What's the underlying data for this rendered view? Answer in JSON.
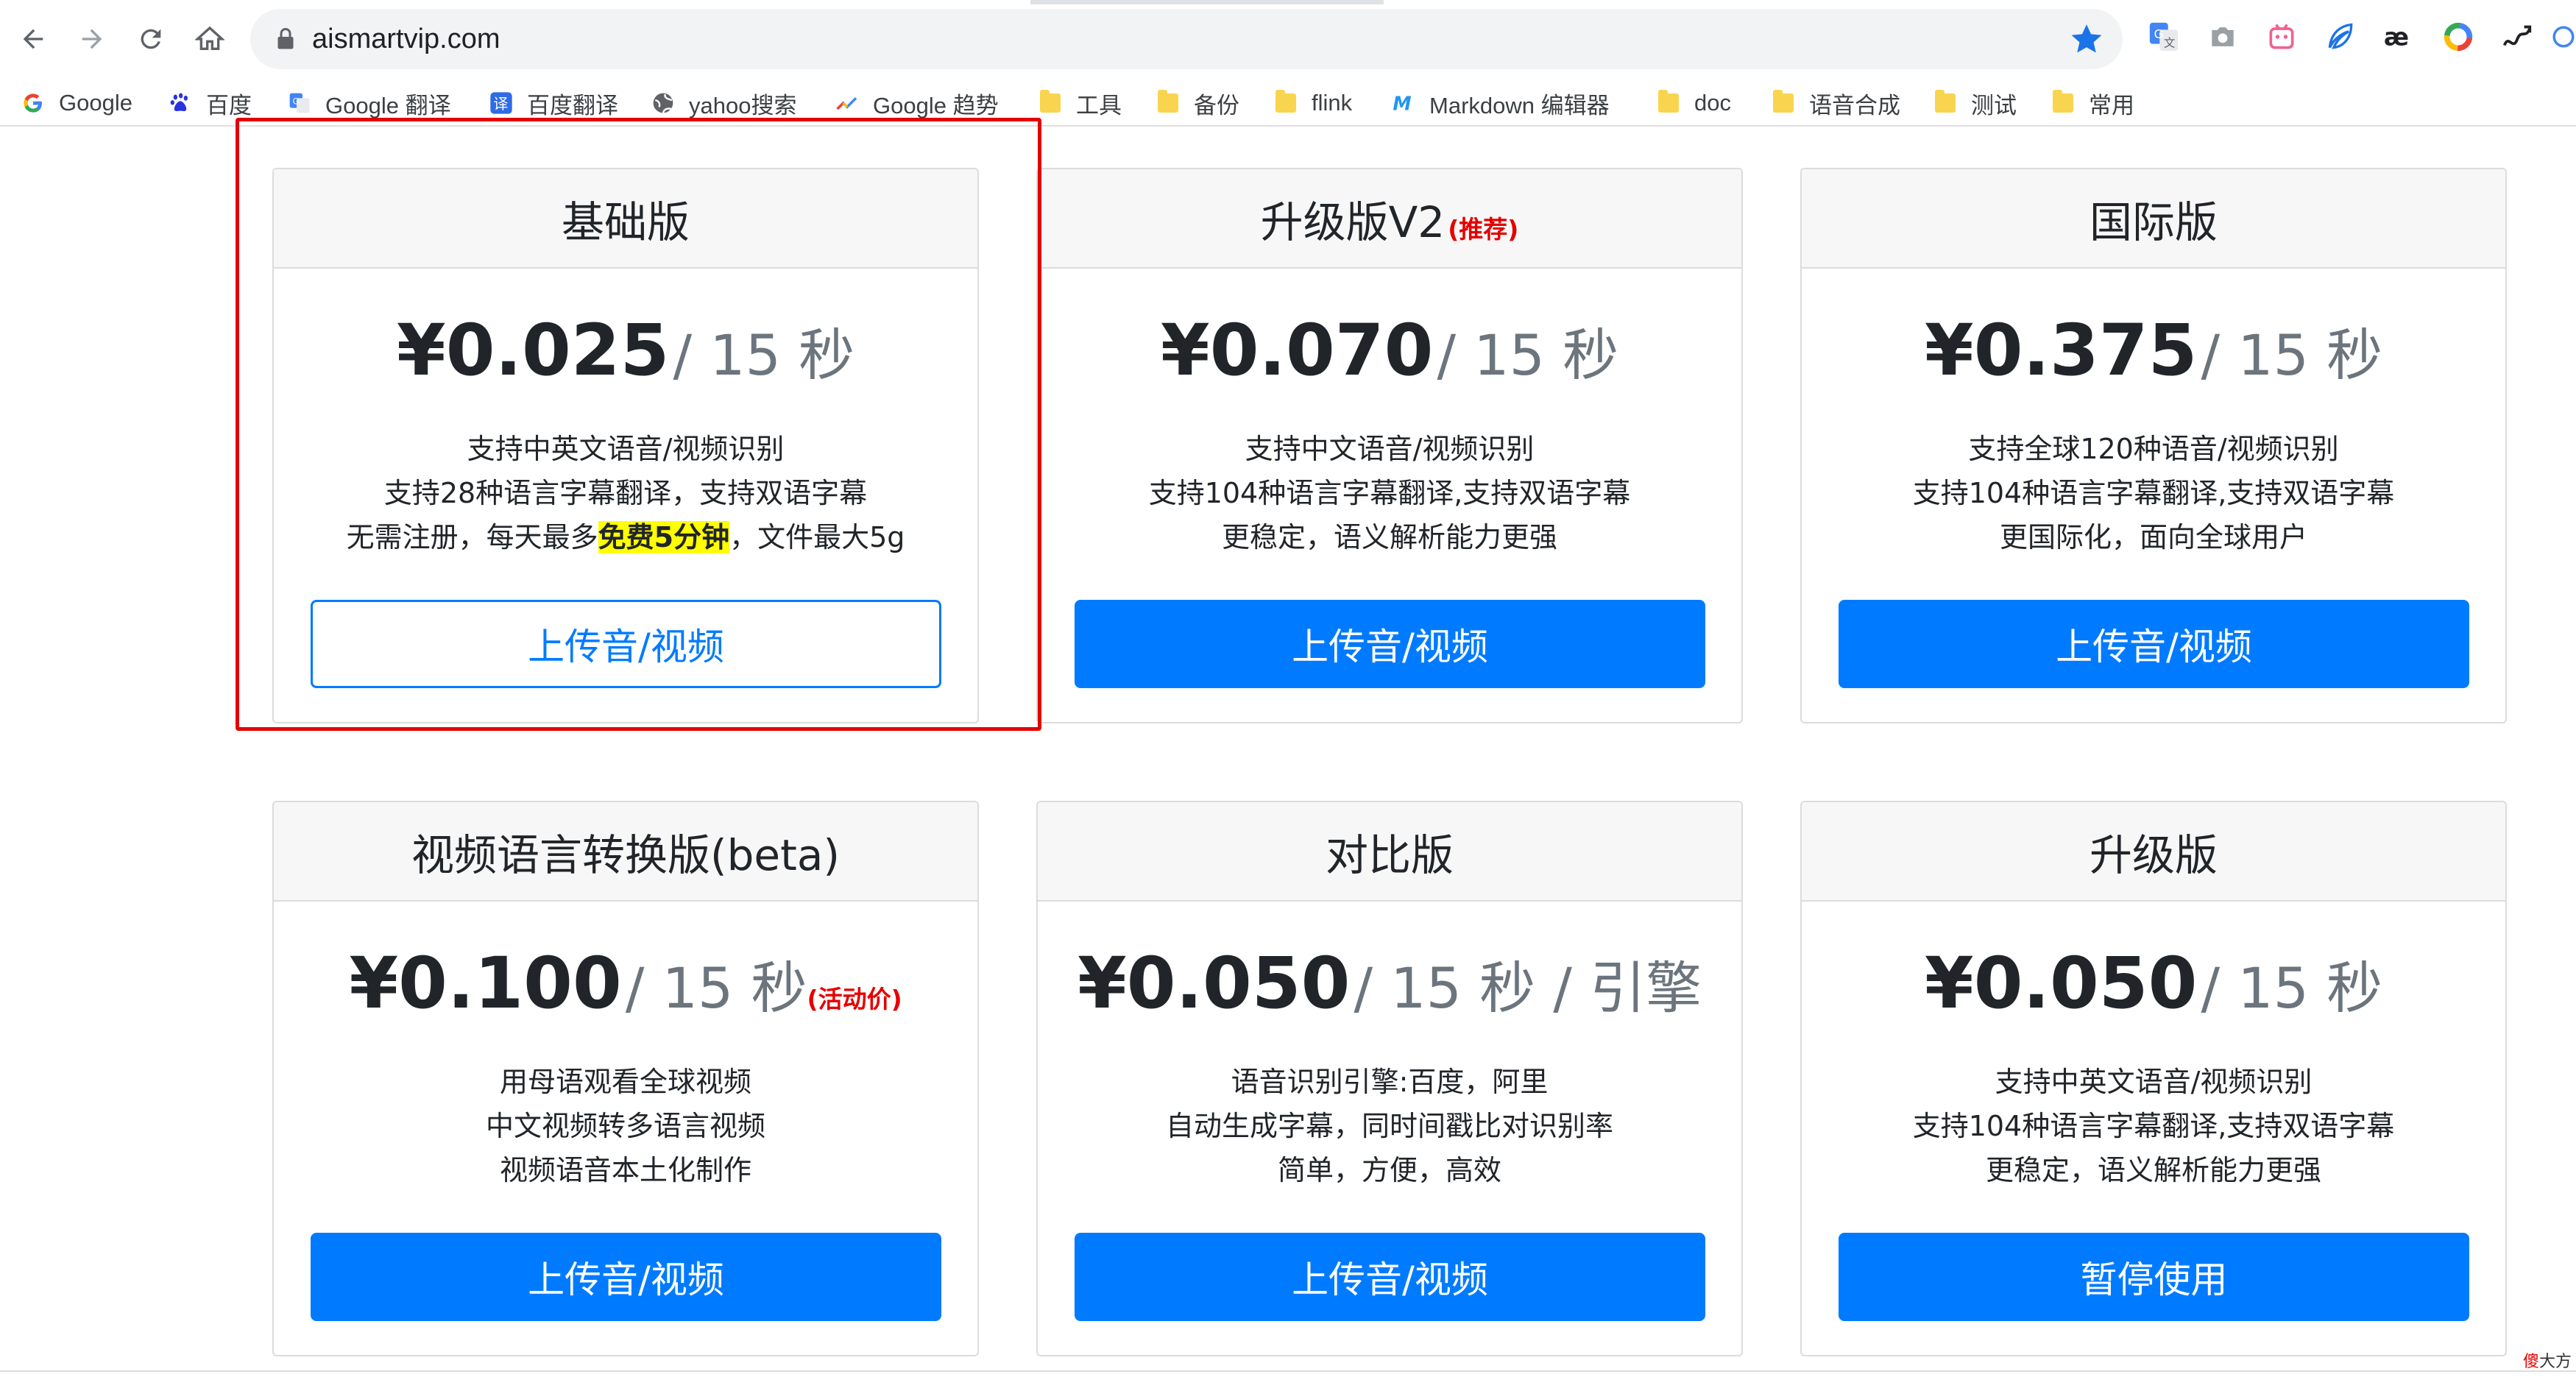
{
  "browser": {
    "url": "aismartvip.com",
    "bookmarks": [
      {
        "label": "Google",
        "icon": "google-icon"
      },
      {
        "label": "百度",
        "icon": "baidu-paw-icon"
      },
      {
        "label": "Google 翻译",
        "icon": "google-translate-icon"
      },
      {
        "label": "百度翻译",
        "icon": "baidu-translate-icon"
      },
      {
        "label": "yahoo搜索",
        "icon": "globe-icon"
      },
      {
        "label": "Google 趋势",
        "icon": "trends-icon"
      },
      {
        "label": "工具",
        "icon": "folder-icon"
      },
      {
        "label": "备份",
        "icon": "folder-icon"
      },
      {
        "label": "flink",
        "icon": "folder-icon"
      },
      {
        "label": "Markdown 编辑器",
        "icon": "markdown-icon"
      },
      {
        "label": "doc",
        "icon": "folder-icon"
      },
      {
        "label": "语音合成",
        "icon": "folder-icon"
      },
      {
        "label": "测试",
        "icon": "folder-icon"
      },
      {
        "label": "常用",
        "icon": "folder-icon"
      }
    ]
  },
  "cards": [
    {
      "title": "基础版",
      "title_note": "",
      "price": "¥0.025",
      "unit": "/ 15 秒",
      "unit_note": "",
      "features": [
        "支持中英文语音/视频识别",
        "支持28种语言字幕翻译，支持双语字幕"
      ],
      "feature3_pre": "无需注册，每天最多",
      "feature3_highlight": "免费5分钟",
      "feature3_post": "，文件最大5g",
      "button": "上传音/视频",
      "button_style": "outline"
    },
    {
      "title": "升级版V2",
      "title_note": "(推荐)",
      "price": "¥0.070",
      "unit": "/ 15 秒",
      "unit_note": "",
      "features": [
        "支持中文语音/视频识别",
        "支持104种语言字幕翻译,支持双语字幕",
        "更稳定，语义解析能力更强"
      ],
      "button": "上传音/视频",
      "button_style": "primary"
    },
    {
      "title": "国际版",
      "title_note": "",
      "price": "¥0.375",
      "unit": "/ 15 秒",
      "unit_note": "",
      "features": [
        "支持全球120种语音/视频识别",
        "支持104种语言字幕翻译,支持双语字幕",
        "更国际化，面向全球用户"
      ],
      "button": "上传音/视频",
      "button_style": "primary"
    },
    {
      "title": "视频语言转换版(beta)",
      "title_note": "",
      "price": "¥0.100",
      "unit": "/ 15 秒",
      "unit_note": "(活动价)",
      "features": [
        "用母语观看全球视频",
        "中文视频转多语言视频",
        "视频语音本土化制作"
      ],
      "button": "上传音/视频",
      "button_style": "primary"
    },
    {
      "title": "对比版",
      "title_note": "",
      "price": "¥0.050",
      "unit": "/ 15 秒 / 引擎",
      "unit_note": "",
      "features": [
        "语音识别引擎:百度，阿里",
        "自动生成字幕，同时间戳比对识别率",
        "简单，方便，高效"
      ],
      "button": "上传音/视频",
      "button_style": "primary"
    },
    {
      "title": "升级版",
      "title_note": "",
      "price": "¥0.050",
      "unit": "/ 15 秒",
      "unit_note": "",
      "features": [
        "支持中英文语音/视频识别",
        "支持104种语言字幕翻译,支持双语字幕",
        "更稳定，语义解析能力更强"
      ],
      "button": "暂停使用",
      "button_style": "primary"
    }
  ],
  "watermark": {
    "red": "傻",
    "rest": "大方"
  },
  "colors": {
    "primary": "#007bff",
    "highlight": "#ffff00",
    "annotation_red": "#e50000",
    "note_red": "#e60000"
  }
}
